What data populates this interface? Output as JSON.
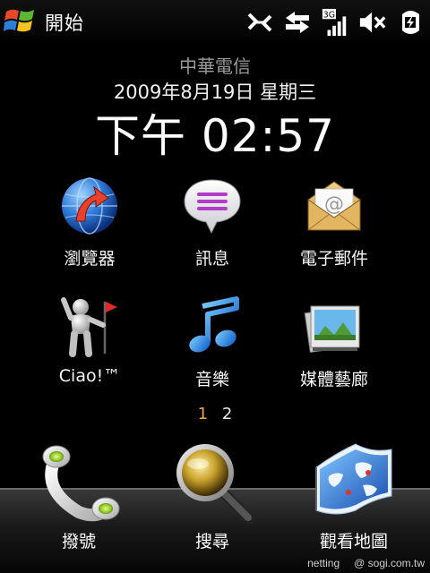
{
  "status_bar": {
    "start_label": "開始",
    "network_badge": "3G",
    "icons": [
      "windows-logo-icon",
      "data-connection-icon",
      "sync-arrows-icon",
      "signal-strength-icon",
      "speaker-muted-icon",
      "battery-charging-icon"
    ]
  },
  "header": {
    "carrier": "中華電信",
    "date": "2009年8月19日 星期三",
    "time": "下午 02:57"
  },
  "tiles": [
    {
      "label": "瀏覽器",
      "icon": "globe-icon"
    },
    {
      "label": "訊息",
      "icon": "message-bubble-icon"
    },
    {
      "label": "電子郵件",
      "icon": "envelope-icon"
    },
    {
      "label": "Ciao!™",
      "icon": "ciao-figure-icon"
    },
    {
      "label": "音樂",
      "icon": "music-note-icon"
    },
    {
      "label": "媒體藝廊",
      "icon": "photo-stack-icon"
    }
  ],
  "pager": {
    "pages": [
      "1",
      "2"
    ],
    "current": "1"
  },
  "dock": [
    {
      "label": "撥號",
      "icon": "phone-handset-icon"
    },
    {
      "label": "搜尋",
      "icon": "magnifier-icon"
    },
    {
      "label": "觀看地圖",
      "icon": "map-icon"
    }
  ],
  "watermark": {
    "user": "netting",
    "site": "@ sogi.com.tw"
  },
  "colors": {
    "background": "#000000",
    "pager_active": "#f4a640",
    "carrier_text": "#9a9a9a"
  }
}
